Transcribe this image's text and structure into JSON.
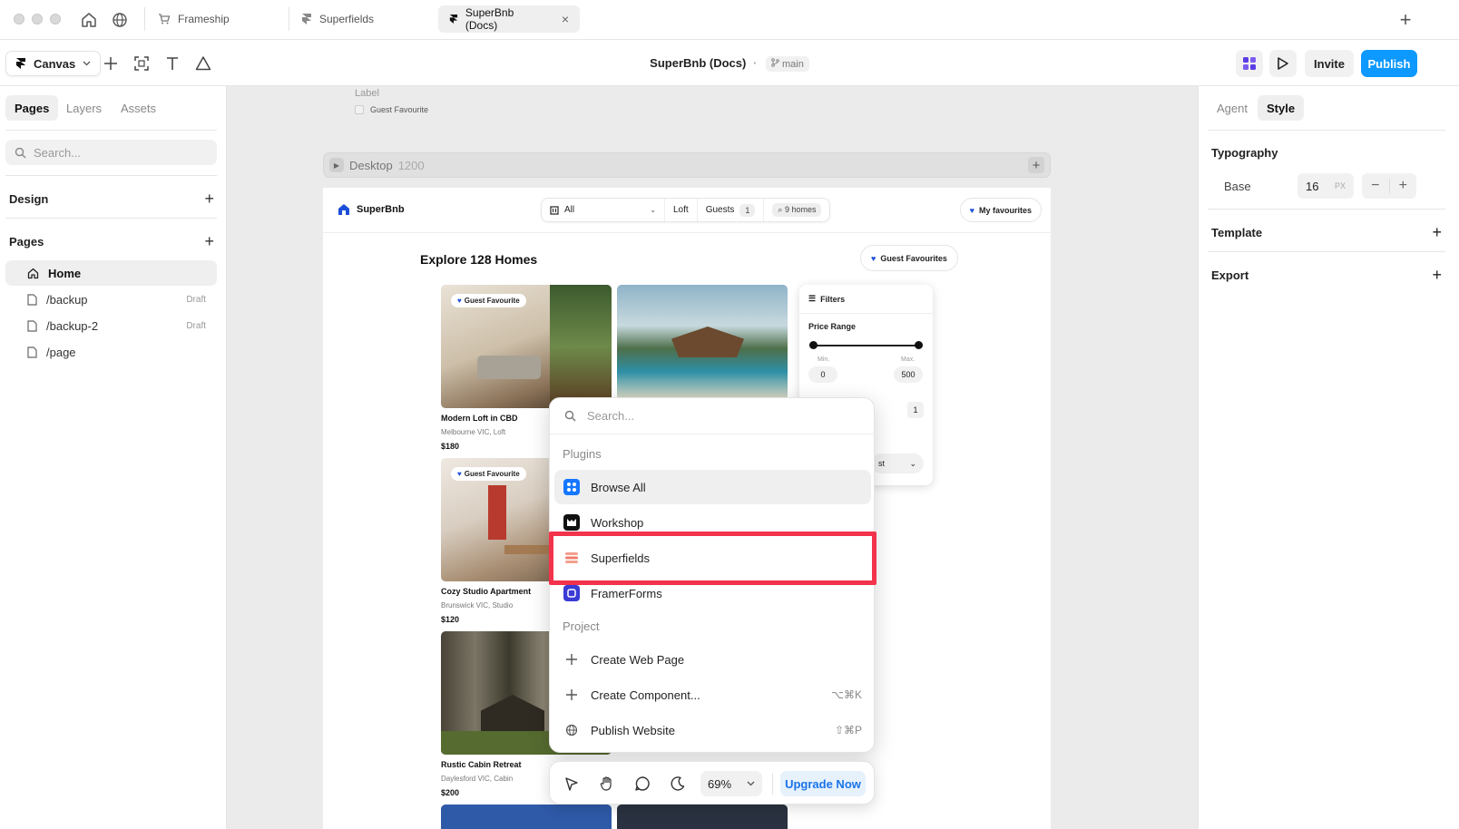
{
  "browser": {
    "tabs": [
      {
        "label": "Frameship"
      },
      {
        "label": "Superfields"
      },
      {
        "label": "SuperBnb (Docs)"
      }
    ],
    "close_glyph": "×",
    "new_tab_glyph": "+"
  },
  "toolbar": {
    "canvas_label": "Canvas",
    "doc_title": "SuperBnb (Docs)",
    "separator": "·",
    "branch": "main",
    "invite_label": "Invite",
    "publish_label": "Publish",
    "accent": "#0d99ff"
  },
  "left_panel": {
    "tabs": [
      "Pages",
      "Layers",
      "Assets"
    ],
    "search_placeholder": "Search...",
    "design_header": "Design",
    "pages_header": "Pages",
    "pages": [
      {
        "label": "Home",
        "badge": ""
      },
      {
        "label": "/backup",
        "badge": "Draft"
      },
      {
        "label": "/backup-2",
        "badge": "Draft"
      },
      {
        "label": "/page",
        "badge": ""
      }
    ]
  },
  "canvas": {
    "label_text": "Label",
    "checkbox_label": "Guest Favourite",
    "frame_name": "Desktop",
    "frame_width": "1200",
    "site": {
      "logo": "SuperBnb",
      "filter_all": "All",
      "filter_loft": "Loft",
      "filter_guests": "Guests",
      "guests_count": "1",
      "homes_count": "9 homes",
      "my_favourites": "My favourites",
      "explore_title": "Explore 128 Homes",
      "guest_favourites_btn": "Guest Favourites",
      "gf_tag": "Guest Favourite",
      "listings": [
        {
          "title": "Modern Loft in CBD",
          "sub": "Melbourne VIC, Loft",
          "price": "$180"
        },
        {
          "title": "Cozy Studio Apartment",
          "sub": "Brunswick VIC, Studio",
          "price": "$120"
        },
        {
          "title": "Rustic Cabin Retreat",
          "sub": "Daylesford VIC, Cabin",
          "price": "$200"
        }
      ],
      "filters": {
        "title": "Filters",
        "price_range": "Price Range",
        "min_label": "Min.",
        "max_label": "Max.",
        "min_value": "0",
        "max_value": "500",
        "count_value": "1",
        "select_partial": "st"
      }
    }
  },
  "command_menu": {
    "search_placeholder": "Search...",
    "plugins_header": "Plugins",
    "plugins": [
      {
        "label": "Browse All"
      },
      {
        "label": "Workshop"
      },
      {
        "label": "Superfields"
      },
      {
        "label": "FramerForms"
      }
    ],
    "project_header": "Project",
    "project_items": [
      {
        "label": "Create Web Page",
        "shortcut": ""
      },
      {
        "label": "Create Component...",
        "shortcut": "⌥⌘K"
      },
      {
        "label": "Publish Website",
        "shortcut": "⇧⌘P"
      }
    ],
    "highlight_color": "#f2334b"
  },
  "bottom_bar": {
    "zoom": "69%",
    "upgrade_label": "Upgrade Now"
  },
  "right_panel": {
    "tabs": [
      "Agent",
      "Style"
    ],
    "typography_header": "Typography",
    "base_label": "Base",
    "base_value": "16",
    "base_unit": "PX",
    "template_header": "Template",
    "export_header": "Export"
  }
}
